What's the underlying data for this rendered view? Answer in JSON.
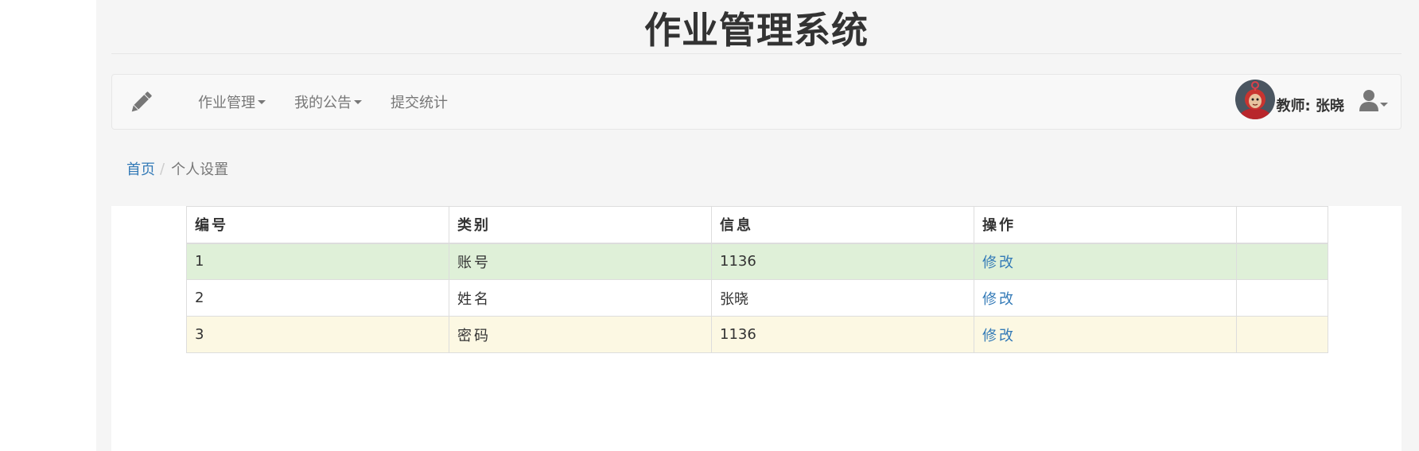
{
  "site_title": "作业管理系统",
  "nav": {
    "brand_icon": "pencil-icon",
    "items": [
      {
        "label": "作业管理",
        "has_dropdown": true
      },
      {
        "label": "我的公告",
        "has_dropdown": true
      },
      {
        "label": "提交统计",
        "has_dropdown": false
      }
    ],
    "teacher_label": "教师: 张晓",
    "user_icon": "user-icon"
  },
  "breadcrumb": {
    "home": "首页",
    "separator": "/",
    "current": "个人设置"
  },
  "table": {
    "headers": [
      "编号",
      "类别",
      "信息",
      "操作",
      ""
    ],
    "rows": [
      {
        "no": "1",
        "category": "账号",
        "info": "1136",
        "action": "修改",
        "style": "success"
      },
      {
        "no": "2",
        "category": "姓名",
        "info": "张晓",
        "action": "修改",
        "style": "default"
      },
      {
        "no": "3",
        "category": "密码",
        "info": "1136",
        "action": "修改",
        "style": "warning"
      }
    ]
  },
  "colors": {
    "link": "#337ab7",
    "success_row": "#dff0d8",
    "warning_row": "#fcf8e3",
    "navbar_bg": "#f8f8f8",
    "page_bg": "#f5f5f5"
  }
}
